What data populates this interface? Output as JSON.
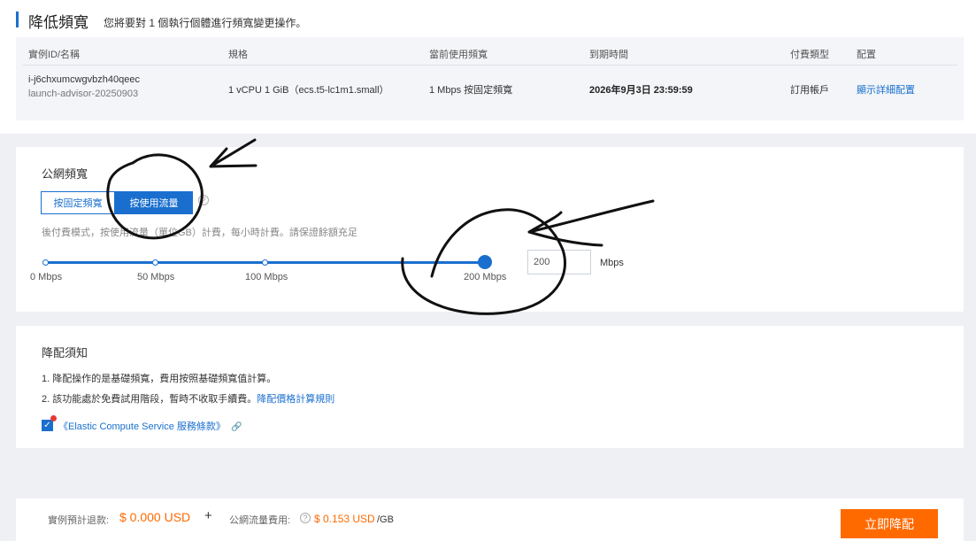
{
  "header": {
    "title": "降低頻寬",
    "subtitle": "您將要對 1 個執行個體進行頻寬變更操作。"
  },
  "table": {
    "columns": [
      "實例ID/名稱",
      "規格",
      "當前使用頻寬",
      "到期時間",
      "付費類型",
      "配置"
    ],
    "row": {
      "instance_id": "i-j6chxumcwgvbzh40qeec",
      "instance_name": "launch-advisor-20250903",
      "spec": "1 vCPU 1 GiB（ecs.t5-lc1m1.small）",
      "current_bandwidth": "1 Mbps 按固定頻寬",
      "expire_time": "2026年9月3日 23:59:59",
      "billing_type": "訂用帳戶",
      "config_link": "顯示詳細配置"
    }
  },
  "bandwidth": {
    "section_label": "公網頻寬",
    "mode_fixed": "按固定頻寬",
    "mode_usage": "按使用流量",
    "help_icon_glyph": "?",
    "description": "後付費模式，按使用流量（單位GB）計費，每小時計費。請保證餘額充足",
    "slider_ticks": [
      "0 Mbps",
      "50 Mbps",
      "100 Mbps",
      "200 Mbps"
    ],
    "slider_value_fraction": 1.0,
    "input_value": "200",
    "unit": "Mbps"
  },
  "notice": {
    "title": "降配須知",
    "line1": "1. 降配操作的是基礎頻寬，費用按照基礎頻寬值計算。",
    "line2": "2. 該功能處於免費試用階段，暫時不收取手續費。",
    "line2_link": "降配價格計算規則",
    "checkbox_glyph": "✓",
    "terms_link": "《Elastic Compute Service 服務條款》",
    "link_icon_glyph": "🔗"
  },
  "footer": {
    "refund_label": "實例預計退款:",
    "refund_amount": "$ 0.000 USD",
    "plus": "+",
    "traffic_label": "公網流量費用:",
    "help_glyph": "?",
    "traffic_amount": "$ 0.153 USD",
    "traffic_unit": "/GB",
    "submit": "立即降配"
  },
  "colors": {
    "accent": "#1a6fce",
    "orange": "#ff6a00",
    "alert_red": "#e53935"
  }
}
